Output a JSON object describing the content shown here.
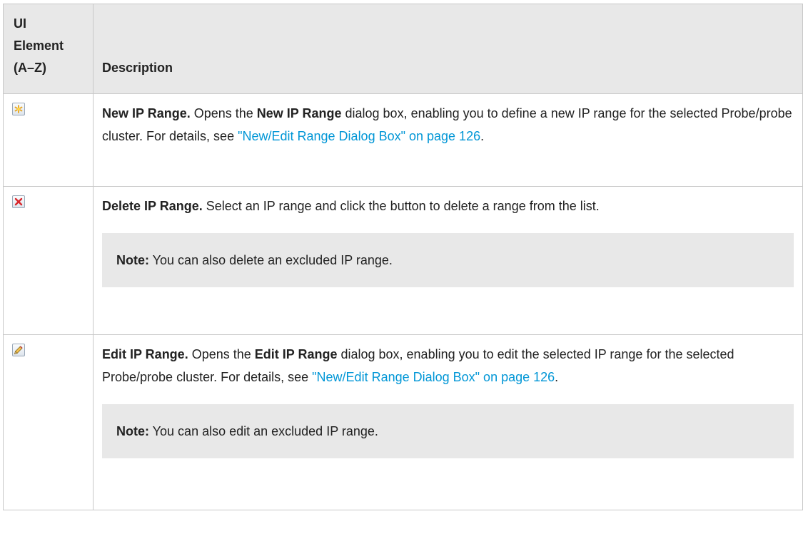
{
  "table": {
    "headers": {
      "ui_element": [
        "UI",
        "Element",
        "(A–Z)"
      ],
      "description": "Description"
    },
    "rows": [
      {
        "icon": "new-star-icon",
        "title": "New IP Range.",
        "text_1": " Opens the ",
        "bold_1": "New IP Range",
        "text_2": " dialog box, enabling you to define a new IP range for the selected Probe/probe cluster. For details, see ",
        "link": "\"New/Edit Range Dialog Box\" on page 126",
        "text_3": "."
      },
      {
        "icon": "delete-x-icon",
        "title": "Delete IP Range.",
        "text_1": " Select an IP range and click the button to delete a range from the list.",
        "note_label": "Note:",
        "note_text": " You can also delete an excluded IP range."
      },
      {
        "icon": "edit-pencil-icon",
        "title": "Edit IP Range.",
        "text_1": " Opens the ",
        "bold_1": "Edit IP Range",
        "text_2": " dialog box, enabling you to edit the selected IP range for the selected Probe/probe cluster. For details, see ",
        "link": "\"New/Edit Range Dialog Box\" on page 126",
        "text_3": ".",
        "note_label": "Note:",
        "note_text": " You can also edit an excluded IP range."
      }
    ]
  },
  "colors": {
    "header_bg": "#e8e8e8",
    "note_bg": "#e8e8e8",
    "border": "#c8c8c8",
    "link": "#0096d6"
  }
}
